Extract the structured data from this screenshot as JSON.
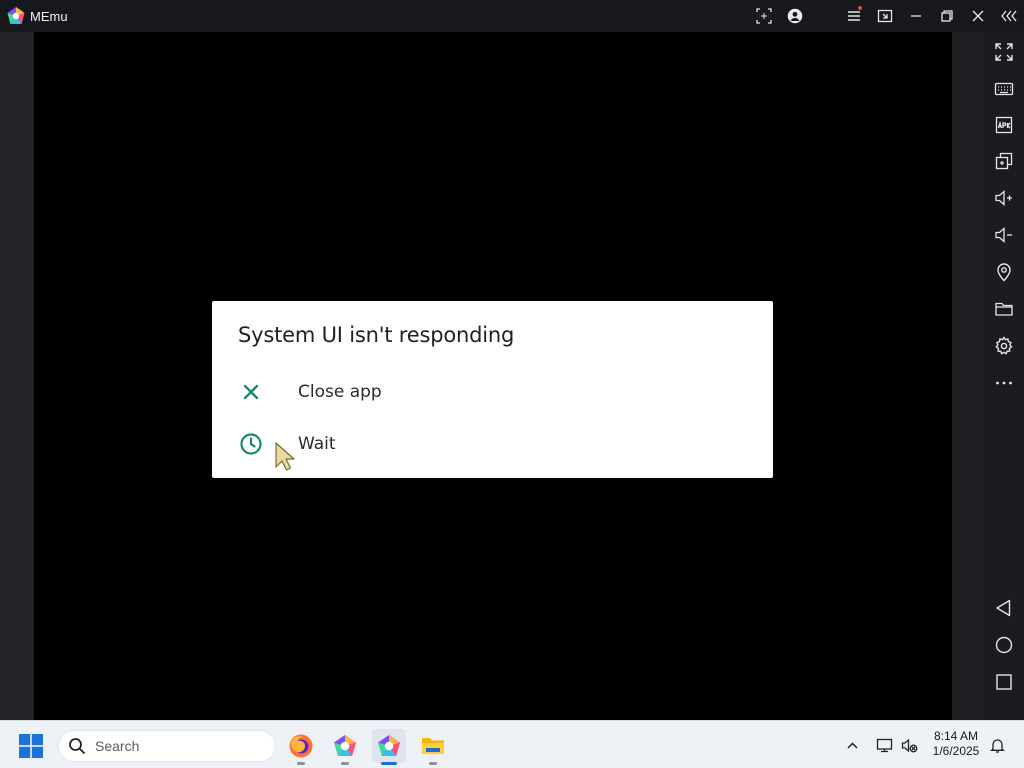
{
  "window": {
    "title": "MEmu"
  },
  "dialog": {
    "title": "System UI isn't responding",
    "options": [
      {
        "label": "Close app",
        "icon": "close-icon"
      },
      {
        "label": "Wait",
        "icon": "clock-icon"
      }
    ],
    "accent_color": "#1a8a6e"
  },
  "taskbar": {
    "search_placeholder": "Search",
    "apps": [
      "firefox",
      "memu-multi",
      "memu",
      "file-explorer"
    ]
  },
  "clock": {
    "time": "8:14 AM",
    "date": "1/6/2025"
  },
  "colors": {
    "titlebar": "#17181b",
    "screen": "#000000",
    "dialog": "#ffffff",
    "taskbar": "#eef2f7"
  }
}
